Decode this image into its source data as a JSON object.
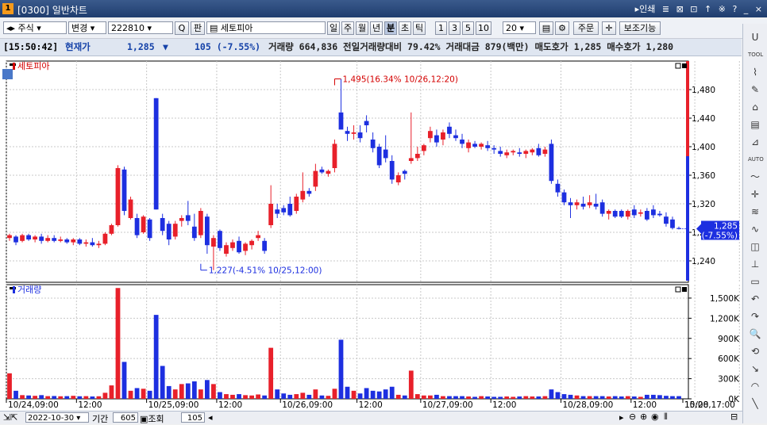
{
  "window": {
    "code": "[0300]",
    "title": "일반차트",
    "right_link": "▸인쇄",
    "right_icons": [
      "≣",
      "⊠",
      "⊡",
      "↑",
      "※",
      "?",
      "_",
      "×"
    ]
  },
  "toolbar": {
    "market_type": "주식",
    "change_label": "변경",
    "stock_code": "222810",
    "search_icon": "Q",
    "pan_label": "판",
    "stock_name": "세토피아",
    "period_buttons": [
      "일",
      "주",
      "월",
      "년",
      "분",
      "초",
      "틱"
    ],
    "active_period": "분",
    "interval_buttons": [
      "1",
      "3",
      "5",
      "10"
    ],
    "interval_value": "20",
    "order_label": "주문",
    "assist_label": "보조기능"
  },
  "quote": {
    "time": "[15:50:42]",
    "current_label": "현재가",
    "price": "1,285",
    "direction": "▼",
    "change": "105 (-7.55%)",
    "rest": "거래량 664,836 전일거래량대비 79.42% 거래대금 879(백만) 매도호가 1,285 매수호가 1,280"
  },
  "chart_data": [
    {
      "type": "candlestick",
      "title": "세토피아",
      "y_ticks": [
        1240,
        1280,
        1320,
        1360,
        1400,
        1440,
        1480
      ],
      "ylim": [
        1210,
        1520
      ],
      "current_price_label": "1,285",
      "current_change_label": "(-7.55%)",
      "current_price": 1285,
      "high_annotation": "1,495(16.34% 10/26,12:20)",
      "high_value": 1495,
      "high_index": 51,
      "low_annotation": "1,227(-4.51% 10/25,12:00)",
      "low_value": 1227,
      "low_index": 30,
      "candles": [
        [
          1272,
          1278,
          1268,
          1276
        ],
        [
          1274,
          1276,
          1262,
          1266
        ],
        [
          1268,
          1278,
          1266,
          1276
        ],
        [
          1276,
          1278,
          1268,
          1270
        ],
        [
          1270,
          1276,
          1266,
          1274
        ],
        [
          1274,
          1278,
          1264,
          1268
        ],
        [
          1268,
          1276,
          1266,
          1272
        ],
        [
          1272,
          1276,
          1266,
          1268
        ],
        [
          1268,
          1274,
          1266,
          1270
        ],
        [
          1270,
          1272,
          1264,
          1266
        ],
        [
          1266,
          1272,
          1262,
          1270
        ],
        [
          1270,
          1272,
          1262,
          1264
        ],
        [
          1264,
          1270,
          1260,
          1266
        ],
        [
          1266,
          1272,
          1260,
          1262
        ],
        [
          1262,
          1268,
          1258,
          1264
        ],
        [
          1264,
          1280,
          1262,
          1278
        ],
        [
          1278,
          1292,
          1276,
          1290
        ],
        [
          1290,
          1374,
          1288,
          1370
        ],
        [
          1368,
          1372,
          1304,
          1310
        ],
        [
          1300,
          1330,
          1298,
          1326
        ],
        [
          1300,
          1306,
          1272,
          1276
        ],
        [
          1280,
          1304,
          1278,
          1302
        ],
        [
          1298,
          1300,
          1268,
          1272
        ],
        [
          1468,
          1468,
          1312,
          1312
        ],
        [
          1300,
          1306,
          1276,
          1282
        ],
        [
          1292,
          1296,
          1262,
          1270
        ],
        [
          1274,
          1296,
          1270,
          1292
        ],
        [
          1296,
          1304,
          1288,
          1300
        ],
        [
          1304,
          1324,
          1290,
          1296
        ],
        [
          1288,
          1306,
          1268,
          1272
        ],
        [
          1276,
          1314,
          1272,
          1310
        ],
        [
          1302,
          1306,
          1250,
          1262
        ],
        [
          1260,
          1276,
          1227,
          1272
        ],
        [
          1282,
          1284,
          1254,
          1258
        ],
        [
          1250,
          1266,
          1246,
          1262
        ],
        [
          1258,
          1270,
          1254,
          1266
        ],
        [
          1268,
          1274,
          1250,
          1252
        ],
        [
          1254,
          1266,
          1248,
          1264
        ],
        [
          1262,
          1270,
          1256,
          1268
        ],
        [
          1272,
          1282,
          1268,
          1276
        ],
        [
          1268,
          1272,
          1250,
          1254
        ],
        [
          1290,
          1346,
          1286,
          1320
        ],
        [
          1312,
          1320,
          1300,
          1306
        ],
        [
          1314,
          1318,
          1304,
          1308
        ],
        [
          1320,
          1330,
          1302,
          1304
        ],
        [
          1310,
          1334,
          1306,
          1330
        ],
        [
          1326,
          1364,
          1322,
          1338
        ],
        [
          1338,
          1342,
          1330,
          1334
        ],
        [
          1344,
          1376,
          1338,
          1366
        ],
        [
          1368,
          1372,
          1362,
          1364
        ],
        [
          1362,
          1368,
          1358,
          1366
        ],
        [
          1370,
          1410,
          1364,
          1404
        ],
        [
          1448,
          1495,
          1448,
          1424
        ],
        [
          1422,
          1428,
          1408,
          1418
        ],
        [
          1418,
          1430,
          1410,
          1420
        ],
        [
          1420,
          1430,
          1406,
          1412
        ],
        [
          1436,
          1444,
          1420,
          1430
        ],
        [
          1410,
          1420,
          1392,
          1398
        ],
        [
          1400,
          1404,
          1370,
          1374
        ],
        [
          1396,
          1416,
          1378,
          1384
        ],
        [
          1380,
          1388,
          1348,
          1354
        ],
        [
          1350,
          1364,
          1346,
          1360
        ],
        [
          1366,
          1368,
          1354,
          1362
        ],
        [
          1380,
          1448,
          1376,
          1384
        ],
        [
          1384,
          1400,
          1380,
          1390
        ],
        [
          1394,
          1404,
          1388,
          1402
        ],
        [
          1412,
          1428,
          1406,
          1422
        ],
        [
          1416,
          1424,
          1400,
          1406
        ],
        [
          1410,
          1424,
          1402,
          1420
        ],
        [
          1428,
          1434,
          1412,
          1418
        ],
        [
          1416,
          1424,
          1408,
          1412
        ],
        [
          1410,
          1418,
          1398,
          1404
        ],
        [
          1398,
          1410,
          1392,
          1406
        ],
        [
          1404,
          1408,
          1398,
          1400
        ],
        [
          1400,
          1406,
          1396,
          1404
        ],
        [
          1402,
          1408,
          1394,
          1398
        ],
        [
          1398,
          1402,
          1390,
          1396
        ],
        [
          1394,
          1400,
          1386,
          1390
        ],
        [
          1388,
          1396,
          1384,
          1392
        ],
        [
          1392,
          1396,
          1388,
          1394
        ],
        [
          1392,
          1398,
          1386,
          1390
        ],
        [
          1390,
          1396,
          1384,
          1394
        ],
        [
          1392,
          1398,
          1388,
          1396
        ],
        [
          1398,
          1404,
          1386,
          1388
        ],
        [
          1390,
          1400,
          1386,
          1396
        ],
        [
          1404,
          1410,
          1348,
          1352
        ],
        [
          1348,
          1354,
          1330,
          1336
        ],
        [
          1336,
          1340,
          1318,
          1322
        ],
        [
          1322,
          1328,
          1300,
          1318
        ],
        [
          1318,
          1326,
          1312,
          1322
        ],
        [
          1320,
          1330,
          1312,
          1316
        ],
        [
          1318,
          1332,
          1314,
          1322
        ],
        [
          1320,
          1334,
          1312,
          1316
        ],
        [
          1322,
          1326,
          1302,
          1306
        ],
        [
          1306,
          1312,
          1298,
          1310
        ],
        [
          1310,
          1312,
          1300,
          1302
        ],
        [
          1310,
          1312,
          1300,
          1302
        ],
        [
          1302,
          1312,
          1298,
          1310
        ],
        [
          1312,
          1318,
          1300,
          1304
        ],
        [
          1306,
          1312,
          1302,
          1308
        ],
        [
          1310,
          1314,
          1296,
          1298
        ],
        [
          1312,
          1318,
          1300,
          1304
        ],
        [
          1306,
          1310,
          1302,
          1304
        ],
        [
          1302,
          1308,
          1288,
          1292
        ],
        [
          1298,
          1302,
          1284,
          1286
        ],
        [
          1286,
          1288,
          1284,
          1285
        ]
      ]
    },
    {
      "type": "bar",
      "title": "거래량",
      "y_tick_labels": [
        "0K",
        "300K",
        "600K",
        "900K",
        "1,200K",
        "1,500K"
      ],
      "y_tick_values": [
        0,
        300000,
        600000,
        900000,
        1200000,
        1500000
      ],
      "ylim": [
        0,
        1700000
      ],
      "values": [
        380000,
        120000,
        55000,
        50000,
        45000,
        55000,
        40000,
        42000,
        38000,
        40000,
        45000,
        38000,
        40000,
        35000,
        38000,
        90000,
        200000,
        1650000,
        550000,
        120000,
        160000,
        150000,
        120000,
        1250000,
        490000,
        190000,
        140000,
        220000,
        230000,
        260000,
        140000,
        280000,
        220000,
        100000,
        70000,
        60000,
        70000,
        55000,
        50000,
        65000,
        50000,
        760000,
        140000,
        80000,
        60000,
        70000,
        90000,
        60000,
        140000,
        50000,
        45000,
        150000,
        880000,
        180000,
        120000,
        80000,
        160000,
        120000,
        110000,
        140000,
        180000,
        60000,
        50000,
        420000,
        70000,
        50000,
        50000,
        60000,
        40000,
        40000,
        40000,
        40000,
        35000,
        30000,
        40000,
        35000,
        30000,
        30000,
        35000,
        30000,
        35000,
        40000,
        35000,
        35000,
        40000,
        140000,
        100000,
        70000,
        60000,
        50000,
        40000,
        40000,
        40000,
        40000,
        35000,
        40000,
        35000,
        40000,
        35000,
        30000,
        60000,
        60000,
        55000,
        45000,
        40000,
        40000
      ]
    }
  ],
  "x_axis": {
    "labels": [
      "10/24,09:00",
      "12:00",
      "10/25,09:00",
      "12:00",
      "10/26,09:00",
      "12:00",
      "10/27,09:00",
      "12:00",
      "10/28,09:00",
      "12:00",
      "15:00",
      "10/28,17:00"
    ],
    "label_indices": [
      0,
      11,
      22,
      33,
      43,
      55,
      65,
      76,
      87,
      98,
      108,
      115
    ]
  },
  "bottom": {
    "date": "2022-10-30",
    "period_label": "기간",
    "period_value": "605",
    "query_label": "조회",
    "count_value": "105"
  },
  "sidebar_icons": [
    "U",
    "TOOL",
    "⌇",
    "✎",
    "⌂",
    "▤",
    "⊿",
    "AUTO",
    "〜",
    "✛",
    "≋",
    "∿",
    "◫",
    "⊥",
    "▭",
    "↶",
    "↷",
    "🔍",
    "⟲",
    "↘",
    "◠",
    "╲"
  ],
  "colors": {
    "up": "#e8202a",
    "down": "#1d2fe0",
    "title_red": "#d40000",
    "price_box": "#1d2fe0"
  }
}
